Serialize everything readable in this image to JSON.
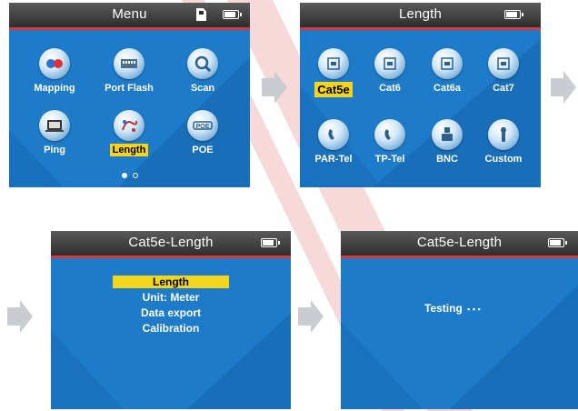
{
  "colors": {
    "screen_bg": "#1d7bc9",
    "title_bar": "#3a3a3a",
    "accent_red": "#d63a3a",
    "highlight": "#f3d51c",
    "arrow": "#c9ccd1",
    "watermark": "#e05555"
  },
  "screen1": {
    "title": "Menu",
    "items": [
      {
        "label": "Mapping",
        "icon": "mapping-icon"
      },
      {
        "label": "Port Flash",
        "icon": "port-flash-icon"
      },
      {
        "label": "Scan",
        "icon": "scan-icon"
      },
      {
        "label": "Ping",
        "icon": "ping-icon"
      },
      {
        "label": "Length",
        "icon": "length-icon",
        "selected": true
      },
      {
        "label": "POE",
        "icon": "poe-icon"
      }
    ],
    "page_indicator": {
      "current": 1,
      "total": 2
    }
  },
  "screen2": {
    "title": "Length",
    "items": [
      {
        "label": "Cat5e",
        "icon": "cat5e-icon",
        "selected": true
      },
      {
        "label": "Cat6",
        "icon": "cat6-icon"
      },
      {
        "label": "Cat6a",
        "icon": "cat6a-icon"
      },
      {
        "label": "Cat7",
        "icon": "cat7-icon"
      },
      {
        "label": "PAR-Tel",
        "icon": "par-tel-icon"
      },
      {
        "label": "TP-Tel",
        "icon": "tp-tel-icon"
      },
      {
        "label": "BNC",
        "icon": "bnc-icon"
      },
      {
        "label": "Custom",
        "icon": "custom-icon"
      }
    ]
  },
  "screen3": {
    "title": "Cat5e-Length",
    "options": [
      "Length",
      "Unit: Meter",
      "Data export",
      "Calibration"
    ],
    "selected_index": 0
  },
  "screen4": {
    "title": "Cat5e-Length",
    "status_text": "Testing",
    "dots": "▪ ▪ ▪"
  }
}
